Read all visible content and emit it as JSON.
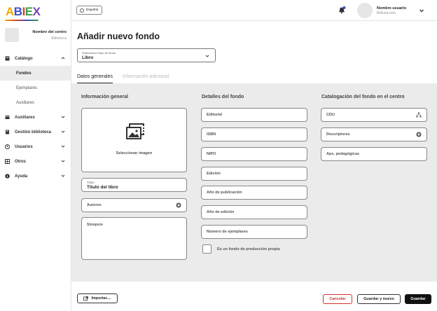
{
  "app": {
    "logo": "ABIEX"
  },
  "sidebar": {
    "center_name": "Nombre del centro",
    "center_role": "Biblioteca",
    "items": [
      {
        "label": "Catálogo",
        "icon": "book-icon",
        "expanded": true
      },
      {
        "label": "Auxiliares",
        "icon": "folder-icon",
        "expanded": false
      },
      {
        "label": "Gestión biblioteca",
        "icon": "library-icon",
        "expanded": false
      },
      {
        "label": "Usuarios",
        "icon": "user-icon",
        "expanded": false
      },
      {
        "label": "Otros",
        "icon": "grid-icon",
        "expanded": false
      },
      {
        "label": "Ayuda",
        "icon": "info-icon",
        "expanded": false
      }
    ],
    "catalog_sub": [
      {
        "label": "Fondos",
        "active": true
      },
      {
        "label": "Ejemplares",
        "active": false
      },
      {
        "label": "Auxiliares",
        "active": false
      }
    ]
  },
  "topbar": {
    "language": "Español",
    "user_name": "Nombre usuario",
    "user_role": "Bibliotecario"
  },
  "main": {
    "title": "Añadir nuevo fondo",
    "type_select": {
      "label": "Selecciona el tipo de fondo",
      "value": "Libro"
    },
    "tabs": [
      {
        "label": "Datos generales",
        "active": true
      },
      {
        "label": "Información adicional",
        "active": false
      }
    ],
    "general": {
      "title": "Información general",
      "image_label": "Seleccionar imagen",
      "title_field": {
        "label": "Título",
        "value": "Título del libro"
      },
      "authors": "Autores",
      "synopsis": "Sinopsis"
    },
    "details": {
      "title": "Detalles del fondo",
      "fields": [
        "Editorial",
        "ISBN",
        "NIPO",
        "Edición",
        "Año de publicación",
        "Año de edición",
        "Número de ejemplares"
      ],
      "own_production": "Es un fondo de producción propia"
    },
    "cataloging": {
      "title": "Catalogación del fondo en el centro",
      "fields": [
        "CDU",
        "Descriptores",
        "Aps. pedagógicas"
      ]
    }
  },
  "footer": {
    "import": "Importar....",
    "cancel": "Cancelar",
    "save_new": "Guardar y nuevo",
    "save": "Guardar"
  },
  "colors": {
    "cancel": "#d23030",
    "primary": "#111111",
    "content_bg": "#ebebeb",
    "notification_dot": "#3a4ec9"
  }
}
